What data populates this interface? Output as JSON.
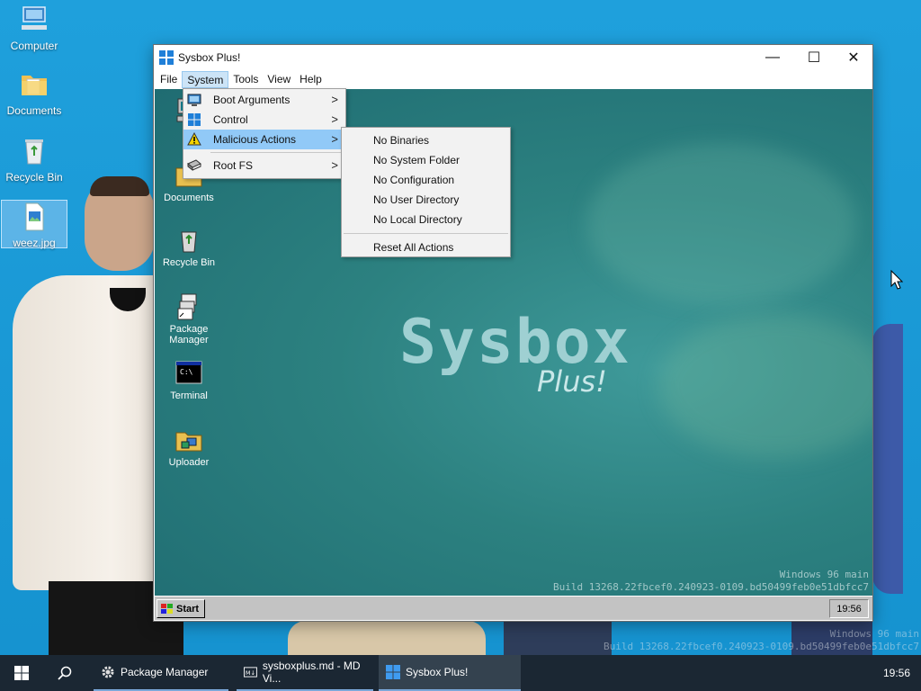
{
  "desktop": {
    "icons": [
      {
        "label": "Computer"
      },
      {
        "label": "Documents"
      },
      {
        "label": "Recycle Bin"
      },
      {
        "label": "weez.jpg"
      }
    ],
    "watermark_line1": "Windows 96 main",
    "watermark_line2": "Build 13268.22fbcef0.240923-0109.bd50499feb0e51dbfcc7"
  },
  "window": {
    "title": "Sysbox Plus!",
    "controls": {
      "minimize": "—",
      "maximize": "☐",
      "close": "✕"
    },
    "menubar": [
      "File",
      "System",
      "Tools",
      "View",
      "Help"
    ],
    "active_menu": "System"
  },
  "system_menu": {
    "items": [
      {
        "label": "Boot Arguments",
        "icon": "monitor-icon"
      },
      {
        "label": "Control",
        "icon": "windows-logo-icon"
      },
      {
        "label": "Malicious Actions",
        "icon": "warning-icon",
        "highlighted": true
      },
      {
        "label": "Root FS",
        "icon": "memory-chip-icon"
      }
    ]
  },
  "malicious_submenu": {
    "items": [
      "No Binaries",
      "No System Folder",
      "No Configuration",
      "No User Directory",
      "No Local Directory"
    ],
    "reset_label": "Reset All Actions"
  },
  "inner_desktop": {
    "icons": [
      {
        "label": "Computer",
        "visible_text": "Co"
      },
      {
        "label": "Documents"
      },
      {
        "label": "Recycle Bin"
      },
      {
        "label": "Package Manager"
      },
      {
        "label": "Terminal"
      },
      {
        "label": "Uploader"
      }
    ],
    "logo_main": "Sysbox",
    "logo_sub": "Plus!",
    "build_line1": "Windows 96 main",
    "build_line2": "Build 13268.22fbcef0.240923-0109.bd50499feb0e51dbfcc7",
    "start_label": "Start",
    "clock": "19:56"
  },
  "taskbar": {
    "apps": [
      {
        "label": "Package Manager",
        "icon": "gear-icon"
      },
      {
        "label": "sysboxplus.md - MD Vi...",
        "icon": "markdown-icon"
      },
      {
        "label": "Sysbox Plus!",
        "icon": "windows-logo-icon",
        "active": true
      }
    ],
    "clock": "19:56"
  },
  "colors": {
    "desktop_bg": "#1a9ad6",
    "menu_highlight": "#91c9f7",
    "taskbar_bg": "#1b2733",
    "inner_bg": "#2c8180"
  }
}
